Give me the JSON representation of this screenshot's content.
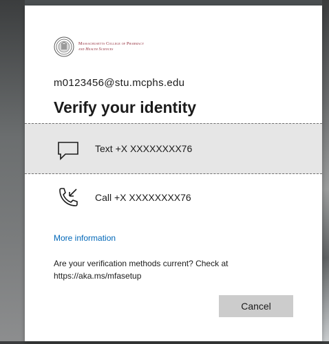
{
  "branding": {
    "line1": "Massachusetts College of Pharmacy",
    "line2": "and Health Sciences"
  },
  "account": {
    "email": "m0123456@stu.mcphs.edu"
  },
  "title": "Verify your identity",
  "options": [
    {
      "label": "Text +X XXXXXXXX76",
      "icon": "message-icon"
    },
    {
      "label": "Call +X XXXXXXXX76",
      "icon": "phone-call-icon"
    }
  ],
  "more_info": "More information",
  "verify_note": "Are your verification methods current? Check at https://aka.ms/mfasetup",
  "buttons": {
    "cancel": "Cancel"
  }
}
